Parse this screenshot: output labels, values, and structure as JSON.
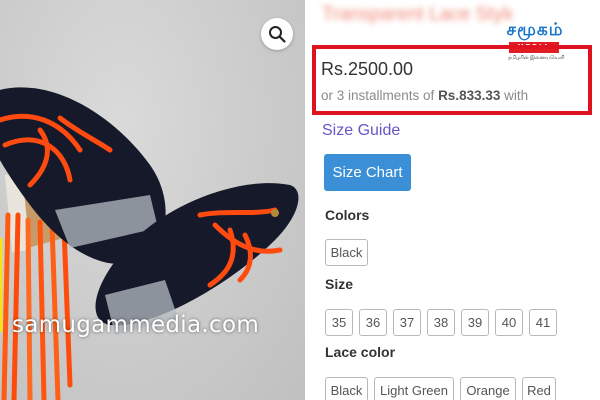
{
  "product": {
    "title_blurred": "Transparent Lace Style",
    "price": "Rs.2500.00",
    "installments_prefix": "or 3 installments of ",
    "installments_amount": "Rs.833.33",
    "installments_suffix": " with"
  },
  "watermark": "samugammedia.com",
  "logo": {
    "name": "சமூகம்",
    "band": "MEDIA",
    "tagline": "தமிழரின் இணையவெளி"
  },
  "size_guide_label": "Size Guide",
  "size_chart_label": "Size Chart",
  "colors": {
    "label": "Colors",
    "options": [
      "Black"
    ]
  },
  "size": {
    "label": "Size",
    "options": [
      "35",
      "36",
      "37",
      "38",
      "39",
      "40",
      "41"
    ]
  },
  "lace_color": {
    "label": "Lace color",
    "options": [
      "Black",
      "Light Green",
      "Orange",
      "Red"
    ]
  },
  "theme": {
    "highlight_border": "#e0121f",
    "size_chart_button": "#3a8fd6",
    "link": "#6a54c8"
  },
  "icons": {
    "zoom": "magnifier-icon"
  }
}
